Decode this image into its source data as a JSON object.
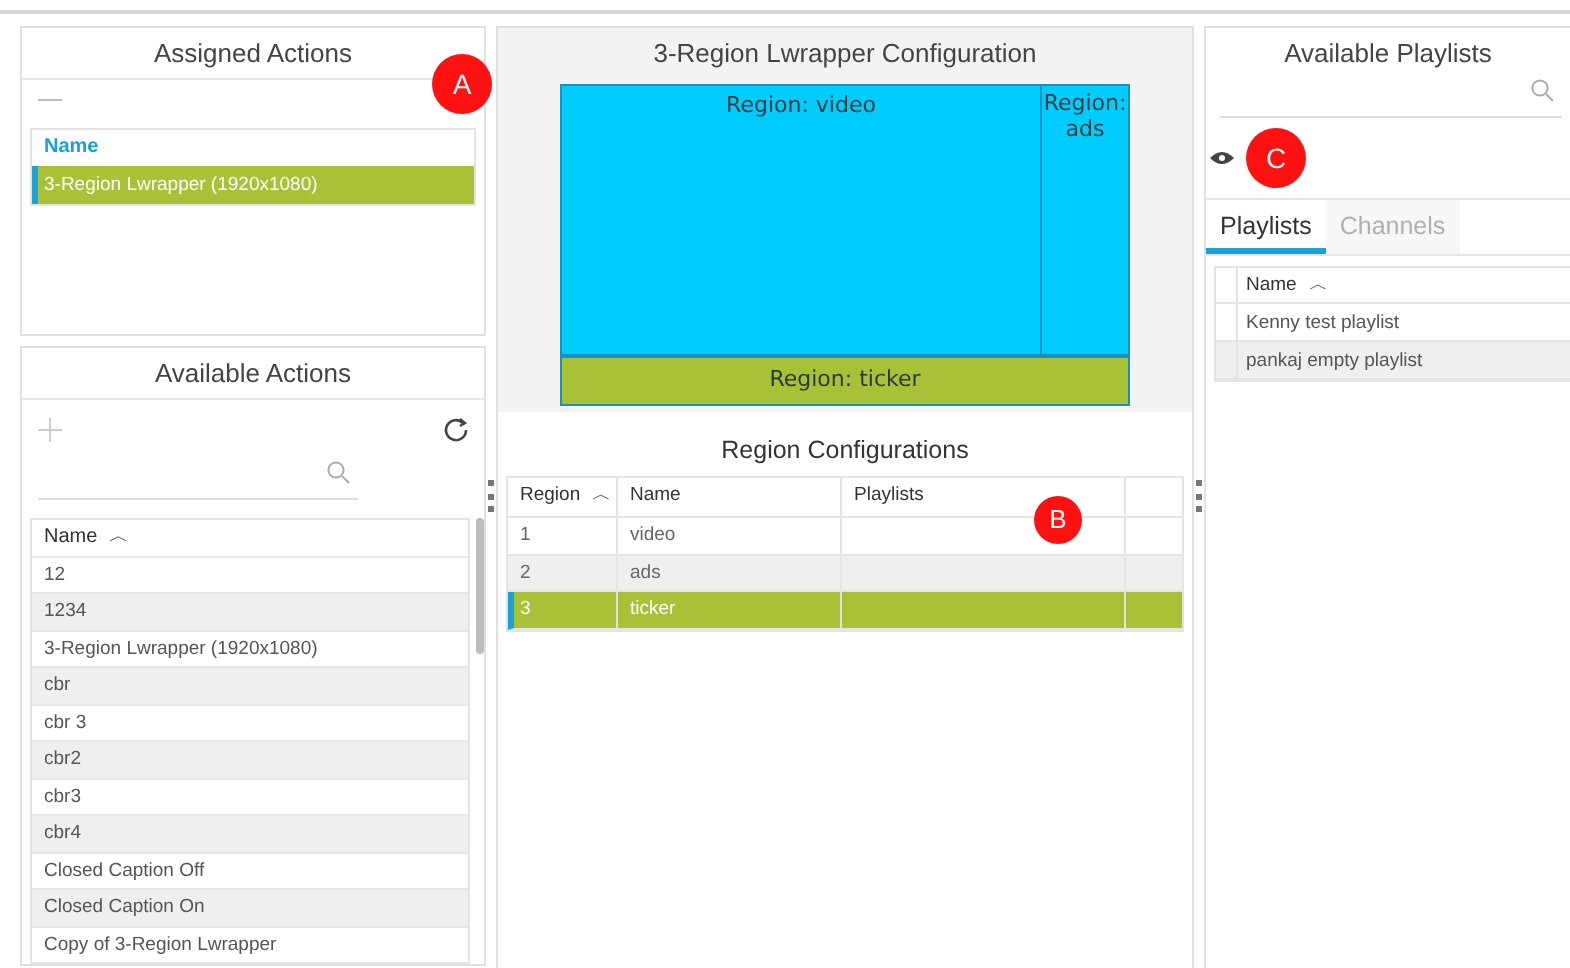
{
  "assigned_actions": {
    "title": "Assigned Actions",
    "column": "Name",
    "rows": [
      {
        "name": "3-Region Lwrapper (1920x1080)",
        "selected": true
      }
    ]
  },
  "available_actions": {
    "title": "Available Actions",
    "column": "Name",
    "sort": "︿",
    "rows": [
      {
        "name": "12",
        "selected": false
      },
      {
        "name": "1234",
        "selected": false
      },
      {
        "name": "3-Region Lwrapper (1920x1080)",
        "selected": false
      },
      {
        "name": "cbr",
        "selected": false
      },
      {
        "name": "cbr 3",
        "selected": false
      },
      {
        "name": "cbr2",
        "selected": false
      },
      {
        "name": "cbr3",
        "selected": false
      },
      {
        "name": "cbr4",
        "selected": false
      },
      {
        "name": "Closed Caption Off",
        "selected": false
      },
      {
        "name": "Closed Caption On",
        "selected": false
      },
      {
        "name": "Copy of 3-Region Lwrapper",
        "selected": false
      }
    ]
  },
  "configuration": {
    "title": "3-Region Lwrapper Configuration",
    "regions": [
      {
        "label": "Region: video",
        "kind": "main"
      },
      {
        "label": "Region: ads",
        "kind": "side"
      },
      {
        "label": "Region: ticker",
        "kind": "bottom"
      }
    ]
  },
  "region_configurations": {
    "title": "Region Configurations",
    "columns": [
      "Region",
      "Name",
      "Playlists"
    ],
    "sort": "︿",
    "rows": [
      {
        "region": "1",
        "name": "video",
        "selected": false
      },
      {
        "region": "2",
        "name": "ads",
        "selected": false
      },
      {
        "region": "3",
        "name": "ticker",
        "selected": true
      }
    ]
  },
  "available_playlists": {
    "title": "Available Playlists",
    "tabs": [
      {
        "label": "Playlists",
        "selected": true
      },
      {
        "label": "Channels",
        "selected": false
      }
    ],
    "column": "Name",
    "sort": "︿",
    "rows": [
      {
        "name": "Kenny test playlist",
        "selected": false
      },
      {
        "name": "pankaj empty playlist",
        "selected": false
      }
    ]
  },
  "callouts": [
    "A",
    "B",
    "C"
  ]
}
